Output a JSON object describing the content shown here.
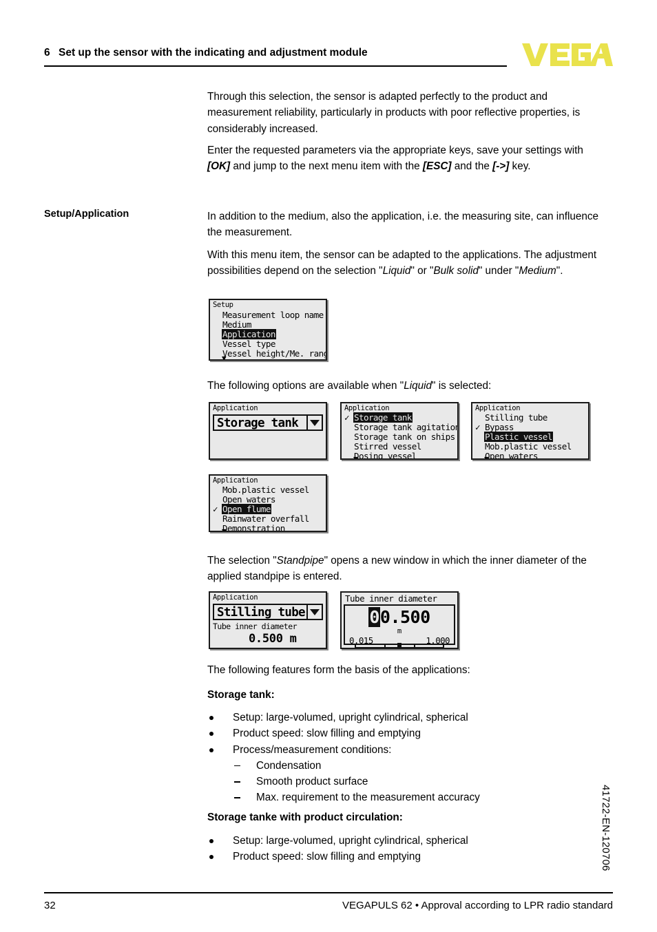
{
  "header": {
    "chapter_number": "6",
    "chapter_title": "Set up the sensor with the indicating and adjustment module",
    "logo": "VEGA"
  },
  "margin_labels": {
    "setup_application": "Setup/Application"
  },
  "paragraphs": {
    "p1_a": "Through this selection, the sensor is adapted perfectly to the product and measurement reliability, particularly in products with poor reflective properties, is considerably increased.",
    "p2_pre": "Enter the requested parameters via the appropriate keys, save your settings with ",
    "p2_ok": "[OK]",
    "p2_mid": " and jump to the next menu item with the ",
    "p2_esc": "[ESC]",
    "p2_mid2": " and the ",
    "p2_arrow": "[->]",
    "p2_end": " key.",
    "p3": "In addition to the medium, also the application, i.e. the measuring site, can influence the measurement.",
    "p4_pre": "With this menu item, the sensor can be adapted to the applications. The adjustment possibilities depend on the selection \"",
    "p4_liquid": "Liquid",
    "p4_mid": "\" or \"",
    "p4_bulk": "Bulk solid",
    "p4_mid2": "\" under \"",
    "p4_medium": "Medium",
    "p4_end": "\".",
    "p5_pre": "The following options are available when \"",
    "p5_liquid": "Liquid",
    "p5_end": "\" is selected:",
    "p6_pre": "The selection \"",
    "p6_standpipe": "Standpipe",
    "p6_end": "\" opens a new window in which the inner diameter of the applied standpipe is entered.",
    "p7": "The following features form the basis of the applications:"
  },
  "headings": {
    "storage_tank": "Storage tank:",
    "storage_tank_circulation": "Storage tanke with product circulation:"
  },
  "lists": {
    "storage_tank": [
      {
        "type": "bullet",
        "text": "Setup: large-volumed, upright cylindrical, spherical"
      },
      {
        "type": "bullet",
        "text": "Product speed: slow filling and emptying"
      },
      {
        "type": "bullet",
        "text": "Process/measurement conditions:"
      },
      {
        "type": "dash",
        "text": "Condensation"
      },
      {
        "type": "dash",
        "text": "Smooth product surface"
      },
      {
        "type": "dash",
        "text": "Max. requirement to the measurement accuracy"
      }
    ],
    "storage_tank_circulation": [
      {
        "type": "bullet",
        "text": "Setup: large-volumed, upright cylindrical, spherical"
      },
      {
        "type": "bullet",
        "text": "Product speed: slow filling and emptying"
      }
    ]
  },
  "screens": {
    "setup_menu": {
      "title": "Setup",
      "rows": [
        {
          "text": "Measurement loop name",
          "selected": false,
          "checked": false
        },
        {
          "text": "Medium",
          "selected": false,
          "checked": false
        },
        {
          "text": "Application",
          "selected": true,
          "checked": false
        },
        {
          "text": "Vessel type",
          "selected": false,
          "checked": false
        },
        {
          "text": "Vessel height/Me. range",
          "selected": false,
          "checked": false
        }
      ],
      "scroll_arrow": "▼"
    },
    "application_value": {
      "title": "Application",
      "value": "Storage tank",
      "dropdown_icon": "chevron-down-icon"
    },
    "application_list_1": {
      "title": "Application",
      "rows": [
        {
          "text": "Storage tank",
          "selected": true,
          "checked": true
        },
        {
          "text": "Storage tank agitation",
          "selected": false,
          "checked": false
        },
        {
          "text": "Storage tank on ships",
          "selected": false,
          "checked": false
        },
        {
          "text": "Stirred vessel",
          "selected": false,
          "checked": false
        },
        {
          "text": "Dosing vessel",
          "selected": false,
          "checked": false
        }
      ],
      "scroll_arrow": "▼"
    },
    "application_list_2": {
      "title": "Application",
      "rows": [
        {
          "text": "Stilling tube",
          "selected": false,
          "checked": false
        },
        {
          "text": "Bypass",
          "selected": false,
          "checked": true
        },
        {
          "text": "Plastic vessel",
          "selected": true,
          "checked": false
        },
        {
          "text": "Mob.plastic vessel",
          "selected": false,
          "checked": false
        },
        {
          "text": "Open waters",
          "selected": false,
          "checked": false
        }
      ],
      "scroll_arrow": "▼"
    },
    "application_list_3": {
      "title": "Application",
      "rows": [
        {
          "text": "Mob.plastic vessel",
          "selected": false,
          "checked": false
        },
        {
          "text": "Open waters",
          "selected": false,
          "checked": false
        },
        {
          "text": "Open flume",
          "selected": true,
          "checked": true
        },
        {
          "text": "Rainwater overfall",
          "selected": false,
          "checked": false
        },
        {
          "text": "Demonstration",
          "selected": false,
          "checked": false
        }
      ],
      "scroll_arrow": "▼"
    },
    "stilling_tube": {
      "title": "Application",
      "value": "Stilling tube",
      "dropdown_icon": "chevron-down-icon",
      "sub_label": "Tube inner diameter",
      "sub_value": "0.500 m"
    },
    "tube_diameter_editor": {
      "title": "Tube inner diameter",
      "cursor_digit": "0",
      "value_rest": "0.500",
      "unit": "m",
      "min": "0.015",
      "max": "1.000"
    }
  },
  "footer": {
    "page_number": "32",
    "text": "VEGAPULS 62 • Approval according to LPR radio standard",
    "doc_code": "41722-EN-120706"
  },
  "colors": {
    "logo_yellow": "#e9e24c",
    "lcd_background": "#e9e9e9",
    "lcd_border": "#1a1a1a",
    "text": "#000000"
  }
}
